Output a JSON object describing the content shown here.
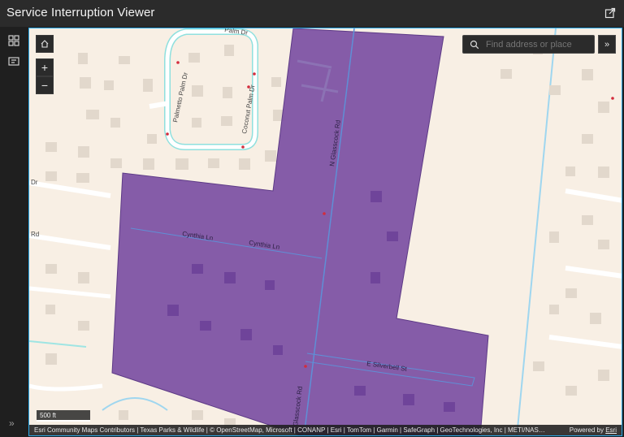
{
  "header": {
    "title": "Service Interruption Viewer",
    "share_icon": "share-icon"
  },
  "sidebar": {
    "widgets_icon": "widgets-icon",
    "legend_icon": "legend-icon",
    "collapse_label": "»"
  },
  "map": {
    "home_icon": "home-icon",
    "zoom_in_label": "+",
    "zoom_out_label": "−",
    "search": {
      "placeholder": "Find address or place",
      "value": ""
    },
    "expand_label": "»",
    "scale_label": "500 ft",
    "attribution": "Esri Community Maps Contributors | Texas Parks & Wildlife | © OpenStreetMap, Microsoft | CONANP | Esri | TomTom | Garmin | SafeGraph | GeoTechnologies, Inc | METI/NASA | ...",
    "powered_by": "Powered by",
    "powered_brand": "Esri",
    "interruption_area_color": "#7b4fa3",
    "street_labels": {
      "palmetto": "Palmetto Palm Dr",
      "coconut": "Coconut Palm Dr",
      "glasscock_n": "N Glasscock Rd",
      "glasscock_s": "Glasscock Rd",
      "cynthia1": "Cynthia Ln",
      "cynthia2": "Cynthia Ln",
      "silverbell": "E Silverbell St",
      "palm_top": "Palm Dr",
      "dr_left": "Dr",
      "rd_left": "Rd"
    }
  }
}
